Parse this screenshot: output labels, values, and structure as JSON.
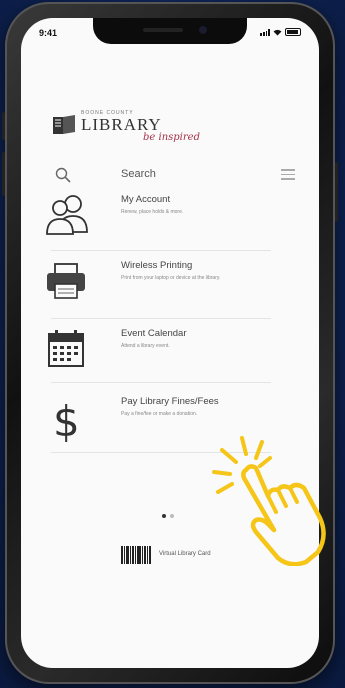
{
  "status_bar": {
    "time": "9:41"
  },
  "logo": {
    "county": "BOONE COUNTY",
    "word": "LIBRARY",
    "script": "be inspired"
  },
  "search": {
    "label": "Search"
  },
  "menu_items": [
    {
      "title": "My Account",
      "subtitle": "Renew, place holds & more.",
      "icon": "people-icon"
    },
    {
      "title": "Wireless Printing",
      "subtitle": "Print from your laptop or device at the library.",
      "icon": "printer-icon"
    },
    {
      "title": "Event Calendar",
      "subtitle": "Attend a library event.",
      "icon": "calendar-icon"
    },
    {
      "title": "Pay Library Fines/Fees",
      "subtitle": "Pay a fine/fee or make a donation.",
      "icon": "dollar-icon"
    }
  ],
  "pager": {
    "pages": 2,
    "active": 1
  },
  "virtual_card": {
    "label": "Virtual Library Card",
    "icon": "barcode-icon"
  },
  "colors": {
    "background": "#0f2457",
    "accent_script": "#a4324a",
    "hand_pointer": "#f5c518"
  }
}
